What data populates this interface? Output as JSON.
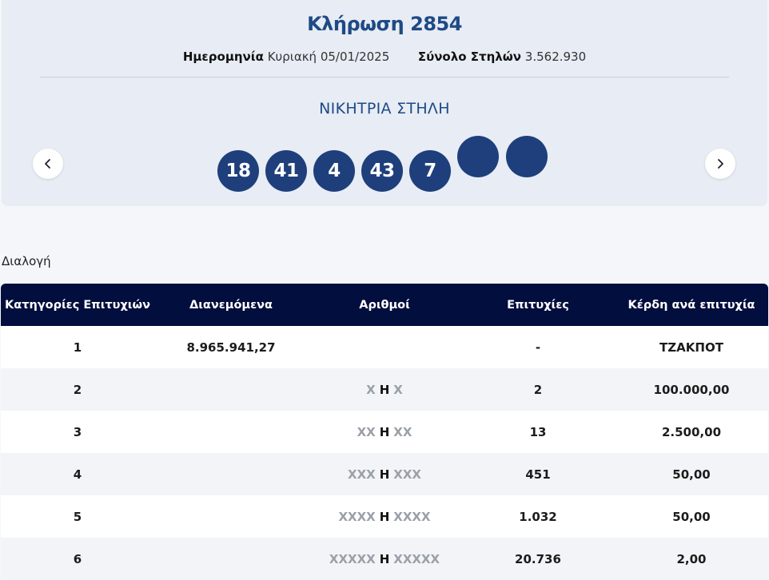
{
  "draw": {
    "title": "Κλήρωση 2854",
    "date_label": "Ημερομηνία",
    "date_value": "Κυριακή 05/01/2025",
    "total_label": "Σύνολο Στηλών",
    "total_value": "3.562.930",
    "winning_label": "ΝΙΚΗΤΡΙΑ ΣΤΗΛΗ",
    "balls": [
      "18",
      "41",
      "4",
      "43",
      "7",
      "",
      ""
    ]
  },
  "section_label": "Διαλογή",
  "table": {
    "headers": [
      "Κατηγορίες Επιτυχιών",
      "Διανεμόμενα",
      "Αριθμοί",
      "Επιτυχίες",
      "Κέρδη ανά επιτυχία"
    ],
    "rows": [
      {
        "category": "1",
        "distributed": "8.965.941,27",
        "combo_left": "",
        "combo_mid": "",
        "combo_right": "",
        "wins": "-",
        "prize": "ΤΖΑΚΠΟΤ"
      },
      {
        "category": "2",
        "distributed": "",
        "combo_left": "X",
        "combo_mid": "Η",
        "combo_right": "X",
        "wins": "2",
        "prize": "100.000,00"
      },
      {
        "category": "3",
        "distributed": "",
        "combo_left": "XX",
        "combo_mid": "Η",
        "combo_right": "XX",
        "wins": "13",
        "prize": "2.500,00"
      },
      {
        "category": "4",
        "distributed": "",
        "combo_left": "XXX",
        "combo_mid": "Η",
        "combo_right": "XXX",
        "wins": "451",
        "prize": "50,00"
      },
      {
        "category": "5",
        "distributed": "",
        "combo_left": "XXXX",
        "combo_mid": "Η",
        "combo_right": "XXXX",
        "wins": "1.032",
        "prize": "50,00"
      },
      {
        "category": "6",
        "distributed": "",
        "combo_left": "XXXXX",
        "combo_mid": "Η",
        "combo_right": "XXXXX",
        "wins": "20.736",
        "prize": "2,00"
      }
    ]
  },
  "icons": {
    "prev": "chevron-left-icon",
    "next": "chevron-right-icon"
  },
  "colors": {
    "accent": "#1e4a86",
    "ball": "#1e3f7b",
    "header_bg": "#020e3d"
  }
}
